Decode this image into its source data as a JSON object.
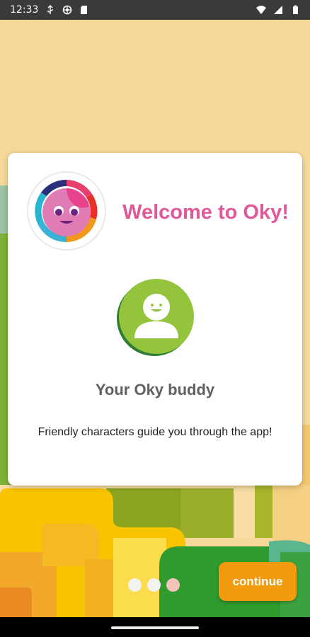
{
  "status_bar": {
    "time": "12:33",
    "left_icons": [
      "usb-icon",
      "vpn-icon",
      "sd-card-icon"
    ],
    "right_icons": [
      "wifi-icon",
      "signal-icon",
      "battery-icon"
    ]
  },
  "card": {
    "welcome_title": "Welcome to Oky!",
    "buddy_title": "Your Oky buddy",
    "buddy_description": "Friendly characters guide you through the app!"
  },
  "pagination": {
    "total": 3,
    "active_index": 2
  },
  "footer": {
    "continue_label": "continue"
  },
  "colors": {
    "title_pink": "#e0589a",
    "button_orange": "#f29b0f",
    "buddy_green": "#8cc63f",
    "background_sand": "#f6d99a"
  }
}
